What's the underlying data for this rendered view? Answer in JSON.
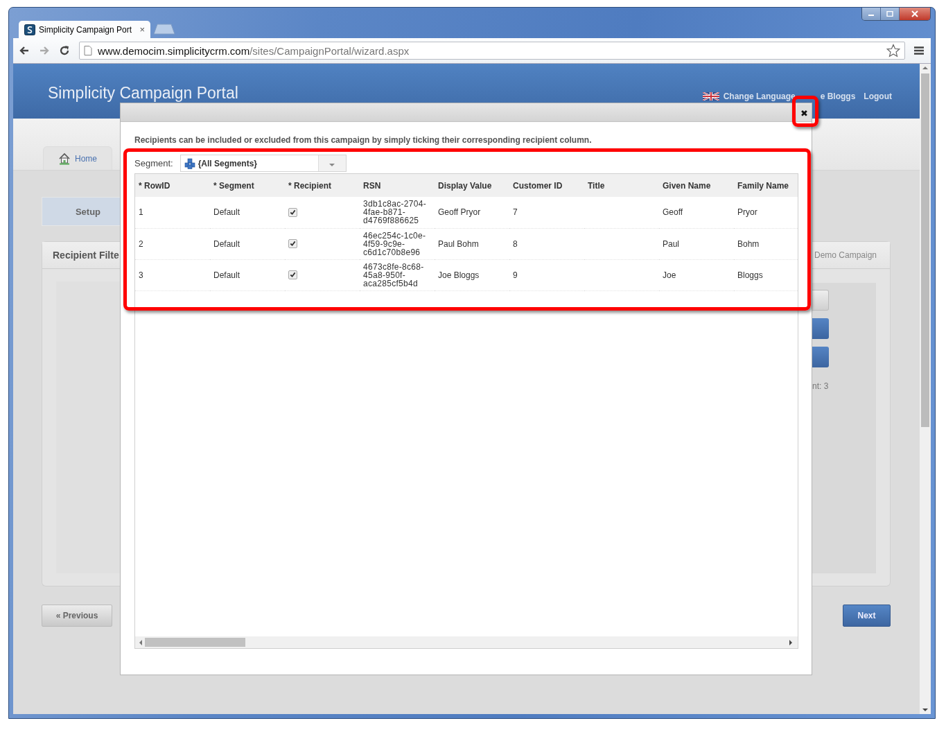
{
  "browser": {
    "tab": {
      "title": "Simplicity Campaign Port",
      "close": "×",
      "selected": true
    },
    "address": {
      "host": "www.democim.simplicitycrm.com",
      "path": "/sites/CampaignPortal/wizard.aspx"
    }
  },
  "header": {
    "title": "Simplicity Campaign Portal",
    "language_link": "Change Language",
    "user": "e Bloggs",
    "logout": "Logout"
  },
  "nav_tabs": [
    {
      "label": "Home",
      "selected": false
    }
  ],
  "steps": [
    {
      "label": "Setup",
      "selected": true
    }
  ],
  "left_panel": {
    "title": "Recipient Filte"
  },
  "right_panel": {
    "title": "Demo Campaign",
    "count": "nt: 3"
  },
  "buttons": {
    "previous": "« Previous",
    "next": "Next"
  },
  "dialog": {
    "close": "✖",
    "intro": "Recipients can be included or excluded from this campaign by simply ticking their corresponding recipient column.",
    "segment_label": "Segment:",
    "segment_value": "{All Segments}",
    "columns": [
      "* RowID",
      "* Segment",
      "* Recipient",
      "RSN",
      "Display Value",
      "Customer ID",
      "Title",
      "Given Name",
      "Family Name"
    ],
    "rows": [
      {
        "row_id": "1",
        "segment": "Default",
        "recipient": true,
        "rsn": "3db1c8ac-2704-4fae-b871-d4769f886625",
        "display_value": "Geoff Pryor",
        "customer_id": "7",
        "title": "",
        "given_name": "Geoff",
        "family_name": "Pryor"
      },
      {
        "row_id": "2",
        "segment": "Default",
        "recipient": true,
        "rsn": "46ec254c-1c0e-4f59-9c9e-c6d1c70b8e96",
        "display_value": "Paul Bohm",
        "customer_id": "8",
        "title": "",
        "given_name": "Paul",
        "family_name": "Bohm"
      },
      {
        "row_id": "3",
        "segment": "Default",
        "recipient": true,
        "rsn": "4673c8fe-8c68-45a8-950f-aca285cf5b4d",
        "display_value": "Joe Bloggs",
        "customer_id": "9",
        "title": "",
        "given_name": "Joe",
        "family_name": "Bloggs"
      }
    ]
  }
}
